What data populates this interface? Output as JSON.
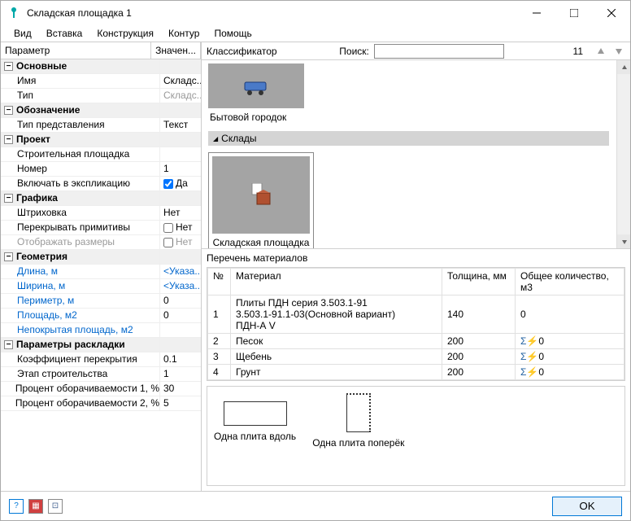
{
  "window_title": "Складская площадка 1",
  "menu": [
    "Вид",
    "Вставка",
    "Конструкция",
    "Контур",
    "Помощь"
  ],
  "prop_header": {
    "col1": "Параметр",
    "col2": "Значен..."
  },
  "groups": [
    {
      "name": "Основные",
      "rows": [
        {
          "label": "Имя",
          "value": "Складс..."
        },
        {
          "label": "Тип",
          "value": "Складс...",
          "grey": true
        }
      ]
    },
    {
      "name": "Обозначение",
      "rows": [
        {
          "label": "Тип представления",
          "value": "Текст"
        }
      ]
    },
    {
      "name": "Проект",
      "rows": [
        {
          "label": "Строительная площадка",
          "value": ""
        },
        {
          "label": "Номер",
          "value": "1"
        },
        {
          "label": "Включать в экспликацию",
          "checkbox": true,
          "checked": true,
          "value": "Да"
        }
      ]
    },
    {
      "name": "Графика",
      "rows": [
        {
          "label": "Штриховка",
          "value": "Нет"
        },
        {
          "label": "Перекрывать примитивы",
          "checkbox": true,
          "checked": false,
          "value": "Нет"
        },
        {
          "label": "Отображать размеры",
          "checkbox": true,
          "checked": false,
          "value": "Нет",
          "grey": true,
          "labelgrey": true
        }
      ]
    },
    {
      "name": "Геометрия",
      "rows": [
        {
          "label": "Длина, м",
          "link": true,
          "value": "<Указа...",
          "placeholder": true
        },
        {
          "label": "Ширина, м",
          "link": true,
          "value": "<Указа...",
          "placeholder": true
        },
        {
          "label": "Периметр, м",
          "link": true,
          "value": "0"
        },
        {
          "label": "Площадь, м2",
          "link": true,
          "value": "0"
        },
        {
          "label": "Непокрытая площадь, м2",
          "link": true,
          "value": ""
        }
      ]
    },
    {
      "name": "Параметры раскладки",
      "rows": [
        {
          "label": "Коэффициент перекрытия",
          "value": "0.1"
        },
        {
          "label": "Этап строительства",
          "value": "1"
        },
        {
          "label": "Процент оборачиваемости 1, %",
          "value": "30"
        },
        {
          "label": "Процент оборачиваемости 2, %",
          "value": "5"
        }
      ]
    }
  ],
  "classifier": {
    "title": "Классификатор",
    "search_label": "Поиск:",
    "search_value": "",
    "count": "11"
  },
  "gallery": {
    "item1_label": "Бытовой городок",
    "group2": "Склады",
    "item2_label": "Складская площадка"
  },
  "materials": {
    "header": "Перечень материалов",
    "cols": {
      "num": "№",
      "mat": "Материал",
      "thick": "Толщина, мм",
      "total": "Общее количество, м3"
    },
    "row1": {
      "num": "1",
      "mat_a": "Плиты ПДН серия 3.503.1-91",
      "mat_b": "3.503.1-91.1-03(Основной вариант)",
      "mat_c": "ПДН-А V",
      "thick": "140",
      "total": "0"
    },
    "rows": [
      {
        "num": "2",
        "mat": "Песок",
        "thick": "200",
        "total": "0"
      },
      {
        "num": "3",
        "mat": "Щебень",
        "thick": "200",
        "total": "0"
      },
      {
        "num": "4",
        "mat": "Грунт",
        "thick": "200",
        "total": "0"
      }
    ]
  },
  "preview": {
    "a": "Одна плита вдоль",
    "b": "Одна плита поперёк"
  },
  "ok": "OK"
}
